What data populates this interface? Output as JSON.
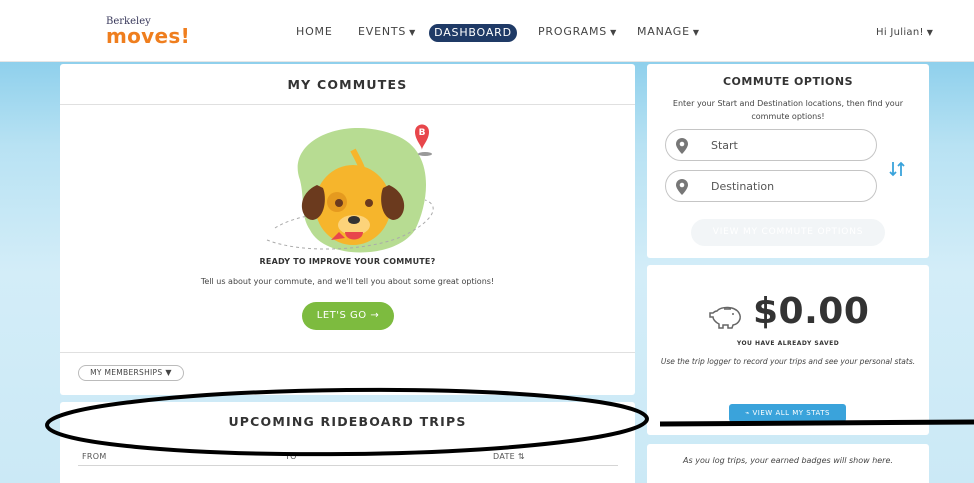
{
  "logo": {
    "top": "Berkeley",
    "main": "moves!"
  },
  "nav": {
    "home": "HOME",
    "events": "EVENTS",
    "dashboard": "DASHBOARD",
    "programs": "PROGRAMS",
    "manage": "MANAGE",
    "greeting": "Hi Julian!"
  },
  "commutes": {
    "title": "MY COMMUTES",
    "ready": "READY TO IMPROVE YOUR COMMUTE?",
    "tell": "Tell us about your commute, and we'll tell you about some great options!",
    "cta": "LET'S GO →",
    "memberships": "MY MEMBERSHIPS",
    "pin_letter": "B"
  },
  "rideboard": {
    "title": "UPCOMING RIDEBOARD TRIPS",
    "columns": [
      "FROM",
      "TO",
      "DATE ⇅"
    ]
  },
  "options": {
    "title": "COMMUTE OPTIONS",
    "description": "Enter your Start and Destination locations, then find your commute options!",
    "start_placeholder": "Start",
    "destination_placeholder": "Destination",
    "view_button": "VIEW MY COMMUTE OPTIONS"
  },
  "savings": {
    "amount": "$0.00",
    "label": "YOU HAVE ALREADY SAVED",
    "logger": "Use the trip logger to record your trips and see your personal stats.",
    "stats_button": "VIEW ALL MY STATS"
  },
  "badges": {
    "text": "As you log trips, your earned badges will show here."
  },
  "colors": {
    "brand_orange": "#ef7e1e",
    "nav_active": "#1f3a66",
    "cta_green": "#7dbb3f",
    "stats_blue": "#3aa3db",
    "pin_red": "#e8464b"
  }
}
